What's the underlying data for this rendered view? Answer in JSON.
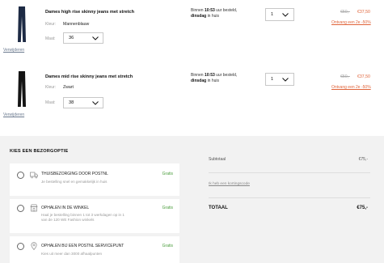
{
  "cart": {
    "items": [
      {
        "name": "Dames high rise skinny jeans met stretch",
        "color_label": "Kleur:",
        "color_value": "Mannenblauw",
        "size_label": "Maat:",
        "size_value": "36",
        "remove_label": "Verwijderen",
        "delivery_prefix": "Binnen",
        "delivery_time": "10:53",
        "delivery_mid": "uur besteld,",
        "delivery_day": "dinsdag",
        "delivery_suffix": "in huis",
        "quantity": "1",
        "old_price": "€50,-",
        "new_price": "€37,50",
        "promo": "Ontvang een 2e -50%",
        "jeans_color": "#1d2a44"
      },
      {
        "name": "Dames mid rise skinny jeans met stretch",
        "color_label": "Kleur:",
        "color_value": "Zwart",
        "size_label": "Maat:",
        "size_value": "38",
        "remove_label": "Verwijderen",
        "delivery_prefix": "Binnen",
        "delivery_time": "10:53",
        "delivery_mid": "uur besteld,",
        "delivery_day": "dinsdag",
        "delivery_suffix": "in huis",
        "quantity": "1",
        "old_price": "€50,-",
        "new_price": "€37,50",
        "promo": "Ontvang een 2e -50%",
        "jeans_color": "#141414"
      }
    ]
  },
  "shipping": {
    "title": "KIES EEN BEZORGOPTIE",
    "options": [
      {
        "title": "THUISBEZORGING DOOR POSTNL",
        "desc": "Je bestelling snel en gemakkelijk in huis",
        "price": "Gratis",
        "icon": "truck-icon"
      },
      {
        "title": "OPHALEN IN DE WINKEL",
        "desc": "Haal je bestelling binnen 1 tot 3 werkdagen op in 1 van de 120 WE Fashion winkels",
        "price": "Gratis",
        "icon": "store-icon"
      },
      {
        "title": "OPHALEN BIJ EEN POSTNL SERVICEPUNT",
        "desc": "Kies uit meer dan 3000 afhaalpunten",
        "price": "Gratis",
        "icon": "location-pin-icon"
      }
    ]
  },
  "summary": {
    "subtotal_label": "Subtotaal",
    "subtotal_value": "€75,-",
    "coupon_label": "Ik heb een kortingscode",
    "total_label": "TOTAAL",
    "total_value": "€75,-"
  },
  "colors": {
    "accent": "#e0643a",
    "free": "#4a9d3c",
    "panel_bg": "#f2f2f2"
  }
}
